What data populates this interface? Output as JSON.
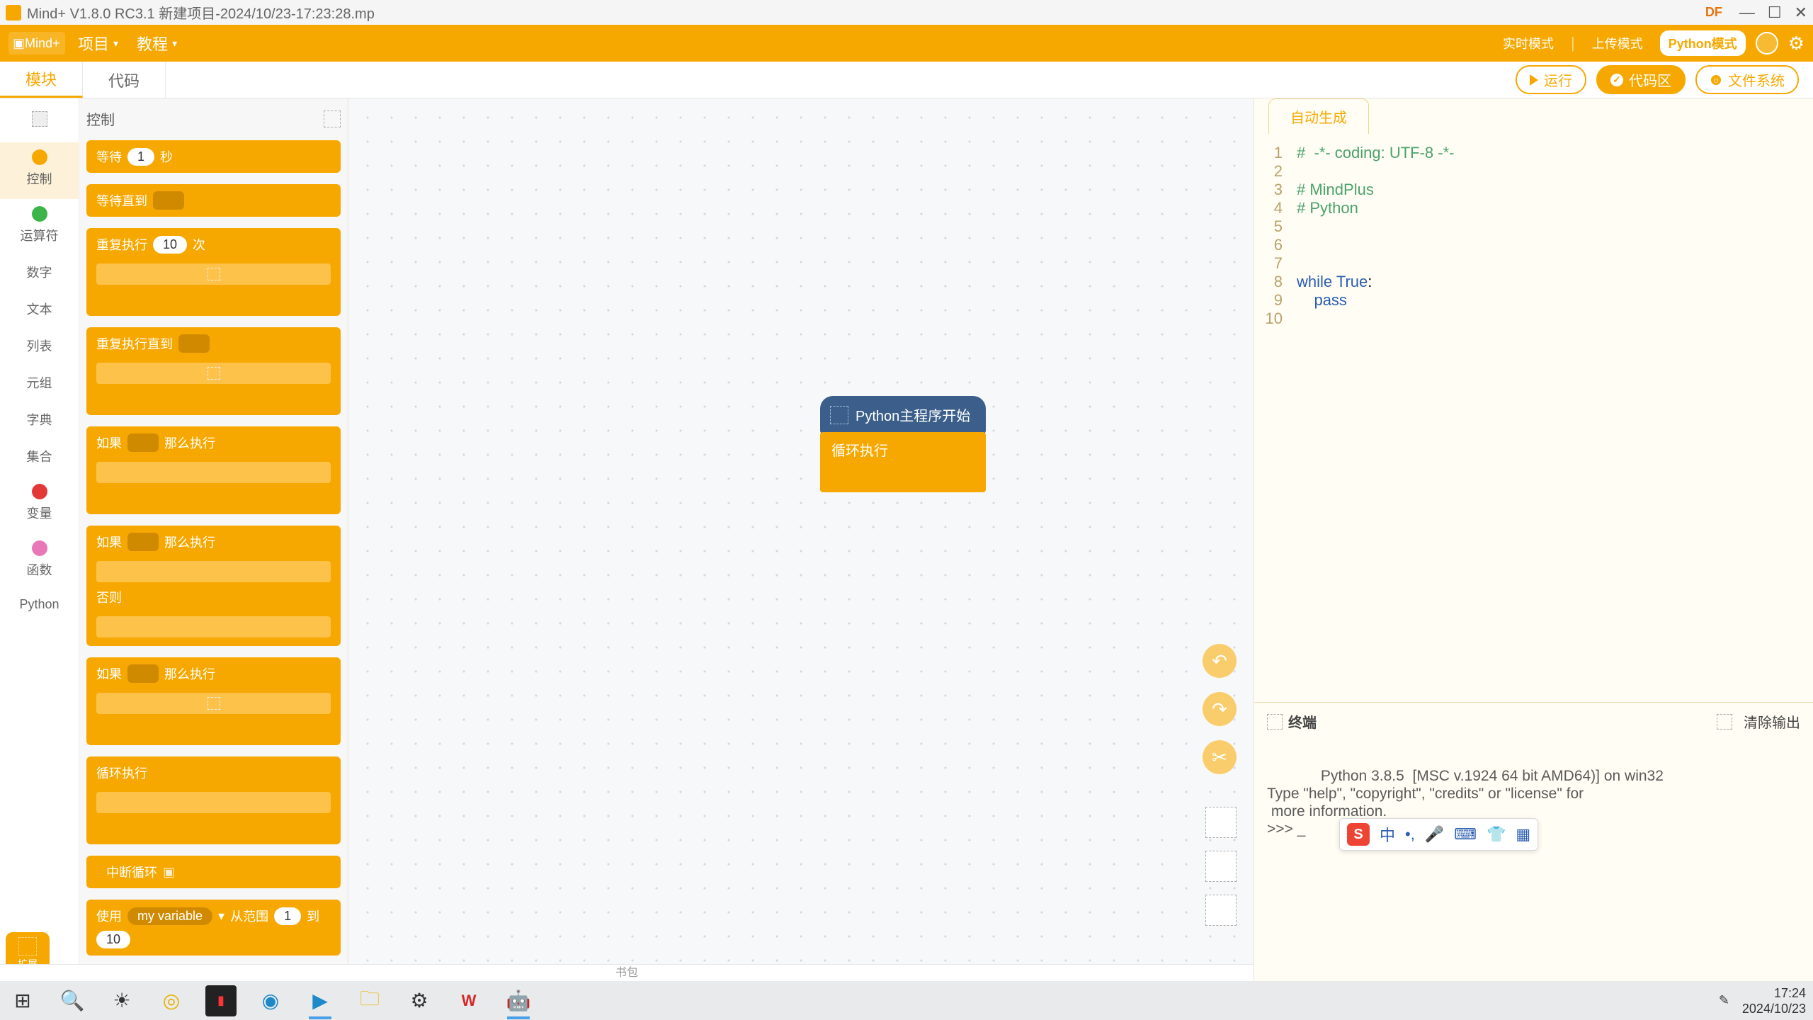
{
  "titlebar": {
    "title": "Mind+ V1.8.0 RC3.1   新建项目-2024/10/23-17:23:28.mp",
    "df": "DF"
  },
  "header": {
    "logo": "Mind+",
    "menu_project": "项目",
    "menu_tutorial": "教程",
    "mode_realtime": "实时模式",
    "mode_upload": "上传模式",
    "mode_python": "Python模式"
  },
  "tabs": {
    "blocks": "模块",
    "code": "代码"
  },
  "runbar": {
    "run": "运行",
    "codearea": "代码区",
    "filesystem": "文件系统"
  },
  "categories": [
    {
      "label": "",
      "color": ""
    },
    {
      "label": "控制",
      "color": "#f7a800",
      "active": true
    },
    {
      "label": "运算符",
      "color": "#3cb44a"
    },
    {
      "label": "数字",
      "color": ""
    },
    {
      "label": "文本",
      "color": ""
    },
    {
      "label": "列表",
      "color": ""
    },
    {
      "label": "元组",
      "color": ""
    },
    {
      "label": "字典",
      "color": ""
    },
    {
      "label": "集合",
      "color": ""
    },
    {
      "label": "变量",
      "color": "#e23838"
    },
    {
      "label": "函数",
      "color": "#e878b8"
    },
    {
      "label": "Python",
      "color": ""
    }
  ],
  "palette_header": "控制",
  "blocks": {
    "wait_label": "等待",
    "wait_val": "1",
    "wait_unit": "秒",
    "wait_until": "等待直到",
    "repeat_label": "重复执行",
    "repeat_val": "10",
    "repeat_unit": "次",
    "repeat_until": "重复执行直到",
    "if_label": "如果",
    "then_label": "那么执行",
    "else_label": "否则",
    "forever": "循环执行",
    "break": "中断循环",
    "use": "使用",
    "var": "my variable",
    "from": "从范围",
    "from_v": "1",
    "to": "到",
    "to_v": "10"
  },
  "canvas": {
    "hat": "Python主程序开始",
    "loop": "循环执行"
  },
  "code_tab": "自动生成",
  "code_lines": [
    {
      "n": "1",
      "html": "<span class='c-com'>#  -*- coding: UTF-8 -*-</span>"
    },
    {
      "n": "2",
      "html": ""
    },
    {
      "n": "3",
      "html": "<span class='c-com'># MindPlus</span>"
    },
    {
      "n": "4",
      "html": "<span class='c-com'># Python</span>"
    },
    {
      "n": "5",
      "html": ""
    },
    {
      "n": "6",
      "html": ""
    },
    {
      "n": "7",
      "html": ""
    },
    {
      "n": "8",
      "html": "<span class='c-kw'>while</span> <span class='c-kw2'>True</span>:"
    },
    {
      "n": "9",
      "html": "    <span class='c-kw'>pass</span>"
    },
    {
      "n": "10",
      "html": ""
    }
  ],
  "terminal": {
    "title": "终端",
    "clear": "清除输出",
    "text": "Python 3.8.5  [MSC v.1924 64 bit AMD64)] on win32\nType \"help\", \"copyright\", \"credits\" or \"license\" for\n more information.\n>>> _",
    "ime_cn": "中"
  },
  "ext_label": "扩展",
  "bag": "书包",
  "taskbar": {
    "time": "17:24",
    "date": "2024/10/23"
  }
}
